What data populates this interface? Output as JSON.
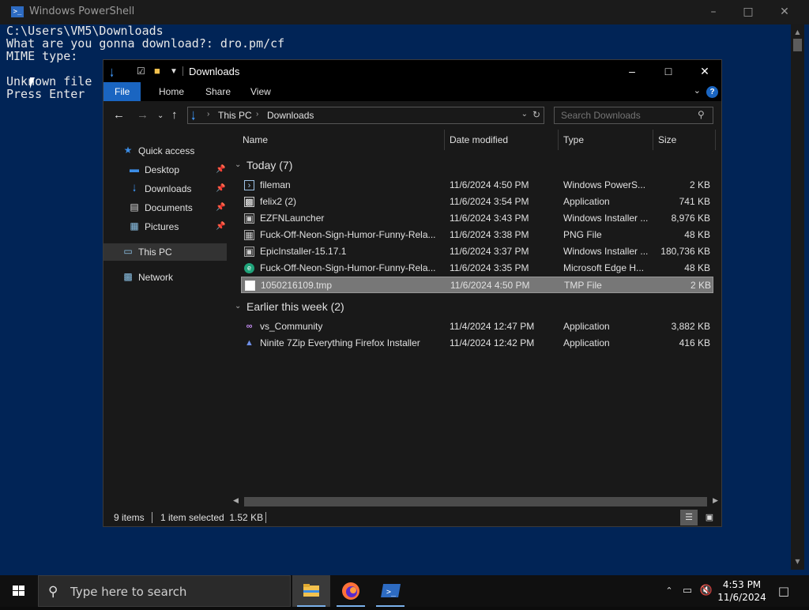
{
  "powershell": {
    "title": "Windows PowerShell",
    "console_lines": [
      "C:\\Users\\VM5\\Downloads",
      "What are you gonna download?: dro.pm/cf",
      "MIME type:",
      "",
      "Unknown file",
      "Press Enter"
    ]
  },
  "explorer": {
    "title": "Downloads",
    "ribbon_tabs": [
      "File",
      "Home",
      "Share",
      "View"
    ],
    "help_label": "?",
    "address": {
      "segments": [
        "This PC",
        "Downloads"
      ]
    },
    "search_placeholder": "Search Downloads",
    "nav_pane": [
      {
        "label": "Quick access",
        "icon": "star-icon"
      },
      {
        "label": "Desktop",
        "icon": "desktop-icon",
        "pinned": true
      },
      {
        "label": "Downloads",
        "icon": "download-icon",
        "pinned": true
      },
      {
        "label": "Documents",
        "icon": "documents-icon",
        "pinned": true
      },
      {
        "label": "Pictures",
        "icon": "pictures-icon",
        "pinned": true
      },
      {
        "label": "This PC",
        "icon": "computer-icon",
        "selected": true
      },
      {
        "label": "Network",
        "icon": "network-icon"
      }
    ],
    "columns": [
      "Name",
      "Date modified",
      "Type",
      "Size"
    ],
    "groups": [
      {
        "label": "Today (7)",
        "files": [
          {
            "name": "fileman",
            "date": "11/6/2024 4:50 PM",
            "type": "Windows PowerS...",
            "size": "2 KB",
            "icon": "script-file-icon"
          },
          {
            "name": "felix2 (2)",
            "date": "11/6/2024 3:54 PM",
            "type": "Application",
            "size": "741 KB",
            "icon": "app-file-icon"
          },
          {
            "name": "EZFNLauncher",
            "date": "11/6/2024 3:43 PM",
            "type": "Windows Installer ...",
            "size": "8,976 KB",
            "icon": "installer-icon"
          },
          {
            "name": "Fuck-Off-Neon-Sign-Humor-Funny-Rela...",
            "date": "11/6/2024 3:38 PM",
            "type": "PNG File",
            "size": "48 KB",
            "icon": "image-file-icon"
          },
          {
            "name": "EpicInstaller-15.17.1",
            "date": "11/6/2024 3:37 PM",
            "type": "Windows Installer ...",
            "size": "180,736 KB",
            "icon": "installer-icon"
          },
          {
            "name": "Fuck-Off-Neon-Sign-Humor-Funny-Rela...",
            "date": "11/6/2024 3:35 PM",
            "type": "Microsoft Edge H...",
            "size": "48 KB",
            "icon": "edge-icon"
          },
          {
            "name": "1050216109.tmp",
            "date": "11/6/2024 4:50 PM",
            "type": "TMP File",
            "size": "2 KB",
            "icon": "blank-file-icon",
            "selected": true
          }
        ]
      },
      {
        "label": "Earlier this week (2)",
        "files": [
          {
            "name": "vs_Community",
            "date": "11/4/2024 12:47 PM",
            "type": "Application",
            "size": "3,882 KB",
            "icon": "visual-studio-icon"
          },
          {
            "name": "Ninite 7Zip Everything Firefox Installer",
            "date": "11/4/2024 12:42 PM",
            "type": "Application",
            "size": "416 KB",
            "icon": "ninite-icon"
          }
        ]
      }
    ],
    "status": {
      "items": "9 items",
      "selected": "1 item selected  1.52 KB"
    }
  },
  "taskbar": {
    "search_placeholder": "Type here to search",
    "apps": [
      "file-explorer-icon",
      "firefox-icon",
      "powershell-icon"
    ],
    "time": "4:53 PM",
    "date": "11/6/2024"
  },
  "colors": {
    "ps_background": "#012456",
    "accent": "#1a65c1"
  }
}
